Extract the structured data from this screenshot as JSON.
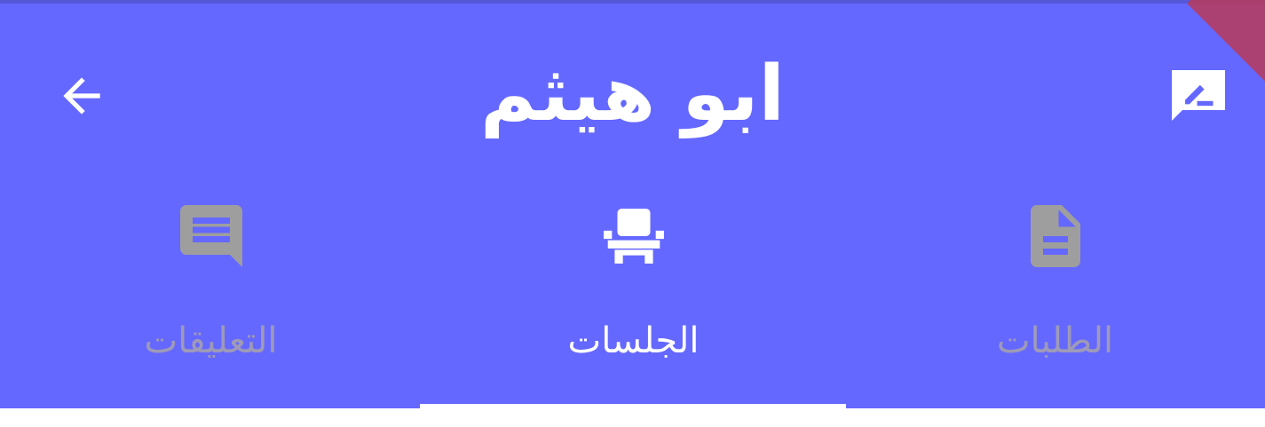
{
  "header": {
    "title": "ابو هيثم",
    "back_icon": "arrow-left-icon",
    "edit_icon": "rate-review-icon"
  },
  "tabs": [
    {
      "label": "التعليقات",
      "icon": "comment-icon",
      "active": false
    },
    {
      "label": "الجلسات",
      "icon": "chair-icon",
      "active": true
    },
    {
      "label": "الطلبات",
      "icon": "description-icon",
      "active": false
    }
  ],
  "colors": {
    "app_bar": "#6568FF",
    "active": "#FFFFFF",
    "inactive_icon": "#9E9E9E",
    "inactive_label": "#9E9AB8",
    "corner_ribbon": "#B73A5B"
  }
}
